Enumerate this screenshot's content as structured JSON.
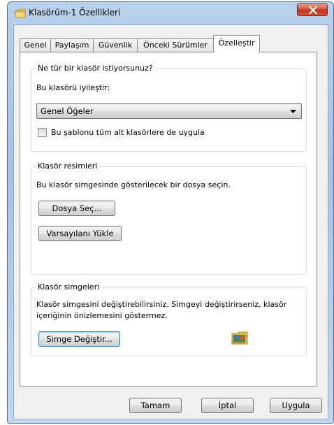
{
  "window": {
    "title": "Klasörüm-1 Özellikleri",
    "close_label": "x"
  },
  "tabs": [
    {
      "label": "Genel"
    },
    {
      "label": "Paylaşım"
    },
    {
      "label": "Güvenlik"
    },
    {
      "label": "Önceki Sürümler"
    },
    {
      "label": "Özelleştir",
      "active": true
    }
  ],
  "optimize_group": {
    "legend": "Ne tür bir klasör istiyorsunuz?",
    "optimize_label": "Bu klasörü iyileştir:",
    "selected_type": "Genel Öğeler",
    "apply_subfolders_label": "Bu şablonu tüm alt klasörlere de uygula",
    "apply_subfolders_checked": false
  },
  "pictures_group": {
    "legend": "Klasör resimleri",
    "description": "Bu klasör simgesinde gösterilecek bir dosya seçin.",
    "choose_file_button": "Dosya Seç...",
    "restore_default_button": "Varsayılanı Yükle"
  },
  "icons_group": {
    "legend": "Klasör simgeleri",
    "description_line1": "Klasör simgesini değiştirebilirsiniz. Simgeyi değiştirirseniz, klasör",
    "description_line2": "içeriğinin önizlemesini göstermez.",
    "change_icon_button": "Simge Değiştir..."
  },
  "footer": {
    "ok_button": "Tamam",
    "cancel_button": "İptal",
    "apply_button": "Uygula"
  }
}
